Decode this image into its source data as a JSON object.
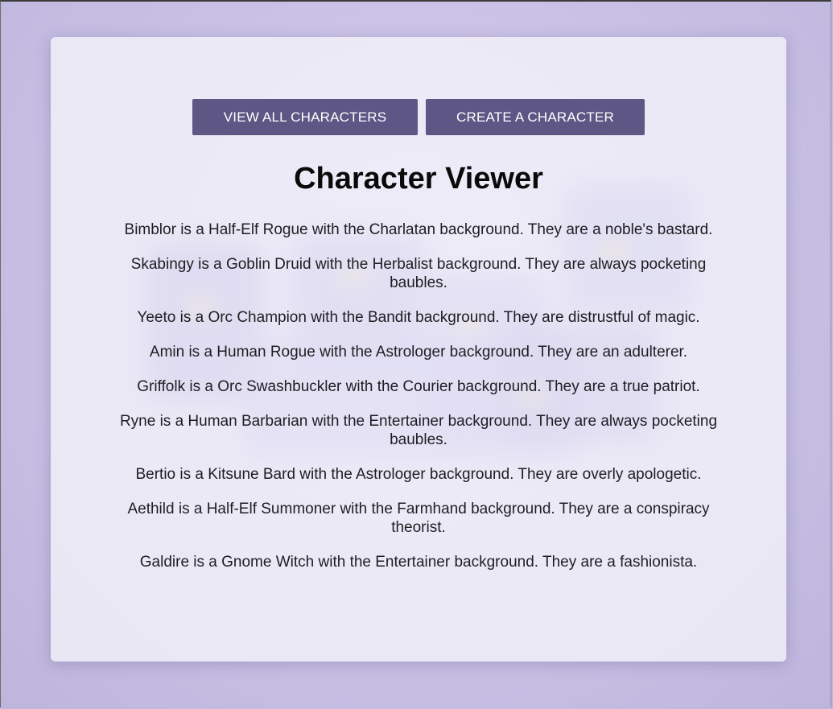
{
  "nav": {
    "view_all_label": "VIEW ALL CHARACTERS",
    "create_label": "CREATE A CHARACTER"
  },
  "page": {
    "title": "Character Viewer"
  },
  "characters": [
    "Bimblor is a Half-Elf Rogue with the Charlatan background. They are a noble's bastard.",
    "Skabingy is a Goblin Druid with the Herbalist background. They are always pocketing baubles.",
    "Yeeto is a Orc Champion with the Bandit background. They are distrustful of magic.",
    "Amin is a Human Rogue with the Astrologer background. They are an adulterer.",
    "Griffolk is a Orc Swashbuckler with the Courier background. They are a true patriot.",
    "Ryne is a Human Barbarian with the Entertainer background. They are always pocketing baubles.",
    "Bertio is a Kitsune Bard with the Astrologer background. They are overly apologetic.",
    "Aethild is a Half-Elf Summoner with the Farmhand background. They are a conspiracy theorist.",
    "Galdire is a Gnome Witch with the Entertainer background. They are a fashionista."
  ],
  "theme": {
    "button_color": "#5e5785",
    "background_color": "#c2bbdf",
    "card_color": "#f4f2fa"
  }
}
